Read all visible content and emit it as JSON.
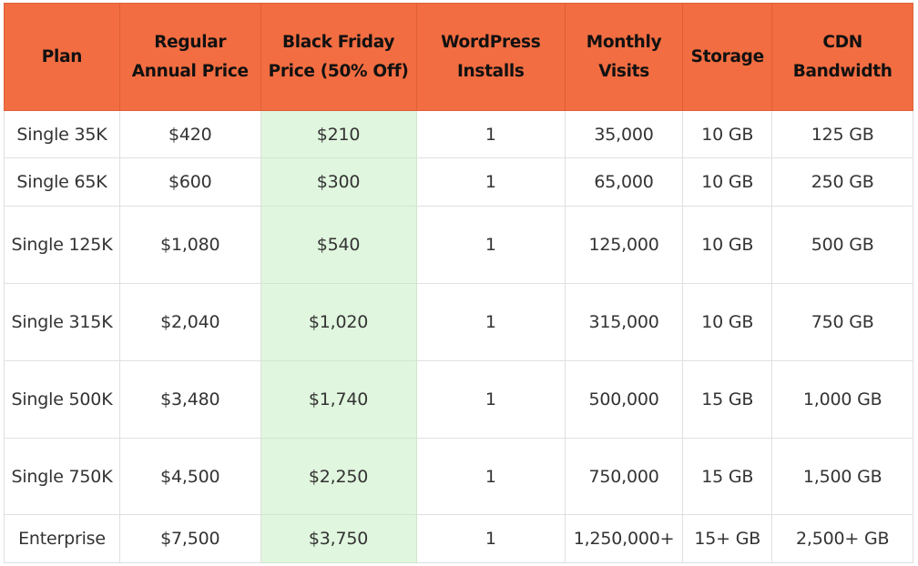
{
  "colors": {
    "header_bg": "#f26d41",
    "highlight_bg": "#e0f6de",
    "text": "#333333",
    "header_text": "#111111"
  },
  "table": {
    "headers": [
      "Plan",
      "Regular Annual Price",
      "Black Friday Price (50% Off)",
      "WordPress Installs",
      "Monthly Visits",
      "Storage",
      "CDN Bandwidth"
    ],
    "rows": [
      [
        "Single 35K",
        "$420",
        "$210",
        "1",
        "35,000",
        "10 GB",
        "125 GB"
      ],
      [
        "Single 65K",
        "$600",
        "$300",
        "1",
        "65,000",
        "10 GB",
        "250 GB"
      ],
      [
        "Single 125K",
        "$1,080",
        "$540",
        "1",
        "125,000",
        "10 GB",
        "500 GB"
      ],
      [
        "Single 315K",
        "$2,040",
        "$1,020",
        "1",
        "315,000",
        "10 GB",
        "750 GB"
      ],
      [
        "Single 500K",
        "$3,480",
        "$1,740",
        "1",
        "500,000",
        "15 GB",
        "1,000 GB"
      ],
      [
        "Single 750K",
        "$4,500",
        "$2,250",
        "1",
        "750,000",
        "15 GB",
        "1,500 GB"
      ],
      [
        "Enterprise",
        "$7,500",
        "$3,750",
        "1",
        "1,250,000+",
        "15+ GB",
        "2,500+ GB"
      ]
    ]
  }
}
